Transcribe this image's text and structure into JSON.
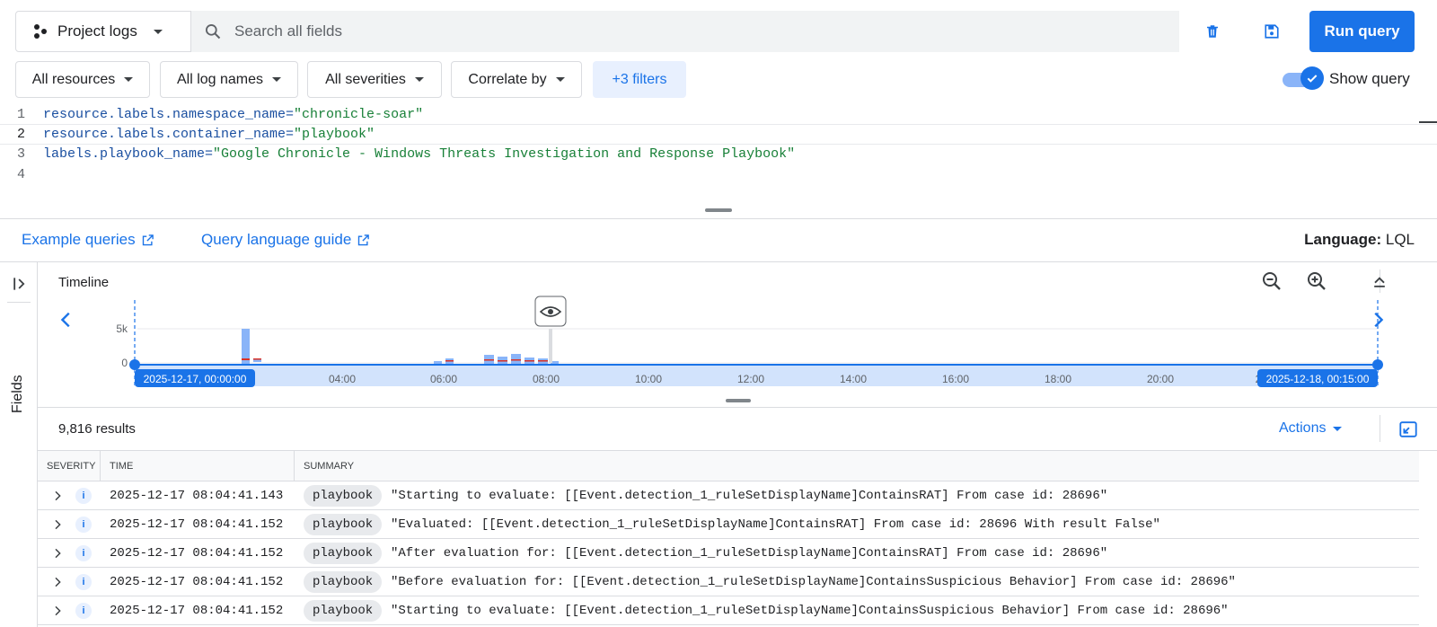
{
  "topbar": {
    "scope_label": "Project logs",
    "search_placeholder": "Search all fields",
    "run_label": "Run query"
  },
  "filters": {
    "resources": "All resources",
    "log_names": "All log names",
    "severities": "All severities",
    "correlate": "Correlate by",
    "more": "+3 filters",
    "show_query_label": "Show query",
    "show_query_on": true
  },
  "editor": {
    "lines": [
      {
        "num": "1",
        "key": "resource.labels.namespace_name=",
        "val": "\"chronicle-soar\""
      },
      {
        "num": "2",
        "key": "resource.labels.container_name=",
        "val": "\"playbook\""
      },
      {
        "num": "3",
        "key": "labels.playbook_name=",
        "val": "\"Google Chronicle - Windows Threats Investigation and Response Playbook\""
      },
      {
        "num": "4",
        "key": "",
        "val": ""
      }
    ]
  },
  "links": {
    "example": "Example queries",
    "guide": "Query language guide",
    "language_label": "Language:",
    "language_value": "LQL"
  },
  "side": {
    "fields_label": "Fields"
  },
  "timeline": {
    "title": "Timeline",
    "y_ticks": [
      "5k",
      "0"
    ],
    "x_ticks": [
      "04:00",
      "06:00",
      "08:00",
      "10:00",
      "12:00",
      "14:00",
      "16:00",
      "18:00",
      "20:00",
      "2"
    ],
    "start_label": "2025-12-17, 00:00:00",
    "end_label": "2025-12-18, 00:15:00"
  },
  "results": {
    "count": "9,816 results",
    "actions": "Actions"
  },
  "table": {
    "headers": [
      "SEVERITY",
      "TIME",
      "SUMMARY"
    ],
    "rows": [
      {
        "sev": "i",
        "time": "2025-12-17 08:04:41.143",
        "chip": "playbook",
        "summary": "\"Starting to evaluate: [[Event.detection_1_ruleSetDisplayName]ContainsRAT] From case id: 28696\""
      },
      {
        "sev": "i",
        "time": "2025-12-17 08:04:41.152",
        "chip": "playbook",
        "summary": "\"Evaluated: [[Event.detection_1_ruleSetDisplayName]ContainsRAT] From case id: 28696 With result False\""
      },
      {
        "sev": "i",
        "time": "2025-12-17 08:04:41.152",
        "chip": "playbook",
        "summary": "\"After evaluation for: [[Event.detection_1_ruleSetDisplayName]ContainsRAT] From case id: 28696\""
      },
      {
        "sev": "i",
        "time": "2025-12-17 08:04:41.152",
        "chip": "playbook",
        "summary": "\"Before evaluation for: [[Event.detection_1_ruleSetDisplayName]ContainsSuspicious Behavior] From case id: 28696\""
      },
      {
        "sev": "i",
        "time": "2025-12-17 08:04:41.152",
        "chip": "playbook",
        "summary": "\"Starting to evaluate: [[Event.detection_1_ruleSetDisplayName]ContainsSuspicious Behavior] From case id: 28696\""
      }
    ]
  },
  "colors": {
    "accent": "#1a73e8",
    "bar_blue": "#8ab4f8",
    "bar_red": "#d93025"
  }
}
